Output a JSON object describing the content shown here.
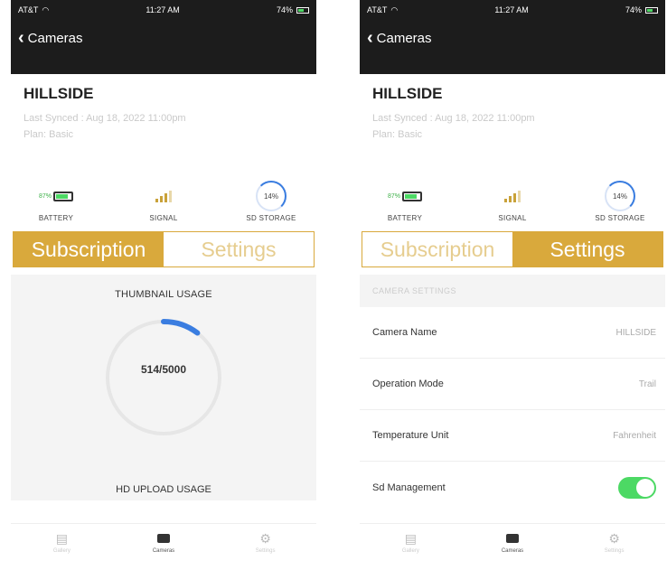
{
  "status_bar": {
    "carrier": "AT&T",
    "time": "11:27 AM",
    "battery": "74%"
  },
  "nav": {
    "back_label": "Cameras"
  },
  "camera": {
    "name": "HILLSIDE",
    "last_synced": "Last Synced : Aug 18, 2022 11:00pm",
    "plan": "Plan: Basic"
  },
  "stats": {
    "battery_pct": "87%",
    "battery_label": "BATTERY",
    "signal_label": "SIGNAL",
    "storage_pct": "14%",
    "storage_label": "SD STORAGE"
  },
  "segmented": {
    "subscription": "Subscription",
    "settings": "Settings"
  },
  "usage": {
    "thumbnail_title": "THUMBNAIL USAGE",
    "thumbnail_value": "514/5000",
    "thumbnail_fraction": 0.103,
    "hd_title": "HD UPLOAD USAGE"
  },
  "settings": {
    "section_title": "CAMERA SETTINGS",
    "rows": [
      {
        "label": "Camera Name",
        "value": "HILLSIDE"
      },
      {
        "label": "Operation Mode",
        "value": "Trail"
      },
      {
        "label": "Temperature Unit",
        "value": "Fahrenheit"
      },
      {
        "label": "Sd Management",
        "toggle": true
      }
    ]
  },
  "tabs": [
    {
      "label": "Gallery",
      "icon": "gallery-icon"
    },
    {
      "label": "Cameras",
      "icon": "camera-icon"
    },
    {
      "label": "Settings",
      "icon": "gear-icon"
    }
  ],
  "colors": {
    "accent": "#d9a93c",
    "header": "#1c1c1c",
    "toggle_on": "#4cd964",
    "ring": "#3a7de0"
  }
}
